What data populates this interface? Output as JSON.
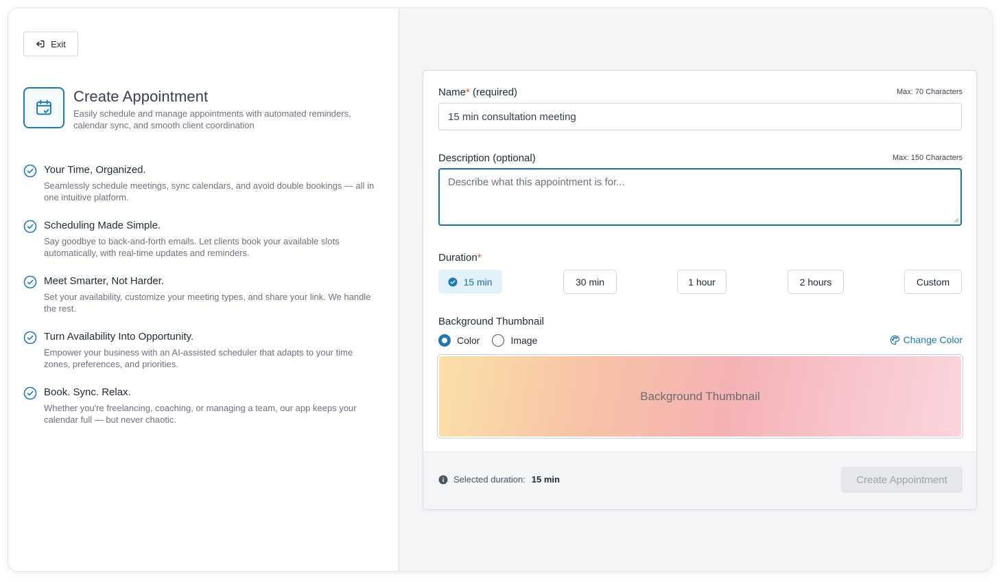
{
  "exit_button": {
    "label": "Exit",
    "icon": "exit-icon"
  },
  "header": {
    "title": "Create Appointment",
    "subtitle": "Easily schedule and manage appointments with automated reminders, calendar sync, and smooth client coordination",
    "icon": "calendar-check-icon"
  },
  "features": [
    {
      "title": "Your Time, Organized.",
      "desc": "Seamlessly schedule meetings, sync calendars, and avoid double bookings — all in one intuitive platform."
    },
    {
      "title": "Scheduling Made Simple.",
      "desc": "Say goodbye to back-and-forth emails. Let clients book your available slots automatically, with real-time updates and reminders."
    },
    {
      "title": "Meet Smarter, Not Harder.",
      "desc": "Set your availability, customize your meeting types, and share your link. We handle the rest."
    },
    {
      "title": "Turn Availability Into Opportunity.",
      "desc": "Empower your business with an AI-assisted scheduler that adapts to your time zones, preferences, and priorities."
    },
    {
      "title": "Book. Sync. Relax.",
      "desc": "Whether you're freelancing, coaching, or managing a team, our app keeps your calendar full — but never chaotic."
    }
  ],
  "form": {
    "name": {
      "label": "Name",
      "required_mark": "*",
      "label_suffix": " (required)",
      "max_note": "Max: 70 Characters",
      "value": "15 min consultation meeting"
    },
    "description": {
      "label": "Description (optional)",
      "max_note": "Max: 150 Characters",
      "placeholder": "Describe what this appointment is for..."
    },
    "duration": {
      "label": "Duration",
      "required_mark": "*",
      "options": [
        "15 min",
        "30 min",
        "1 hour",
        "2 hours",
        "Custom"
      ],
      "selected": "15 min"
    },
    "thumbnail": {
      "label": "Background Thumbnail",
      "options": [
        "Color",
        "Image"
      ],
      "selected": "Color",
      "change_color_label": "Change Color",
      "preview_text": "Background Thumbnail",
      "gradient_colors": [
        "#fbe0a8",
        "#f5b2b4",
        "#fbd5dc"
      ]
    }
  },
  "footer": {
    "info_label": "Selected duration:",
    "info_value": "15 min",
    "create_button": "Create Appointment"
  },
  "colors": {
    "accent": "#1a7ab5",
    "selected_bg": "#e2f2fb",
    "required": "#d9531e",
    "disabled_bg": "#e5e7eb"
  }
}
